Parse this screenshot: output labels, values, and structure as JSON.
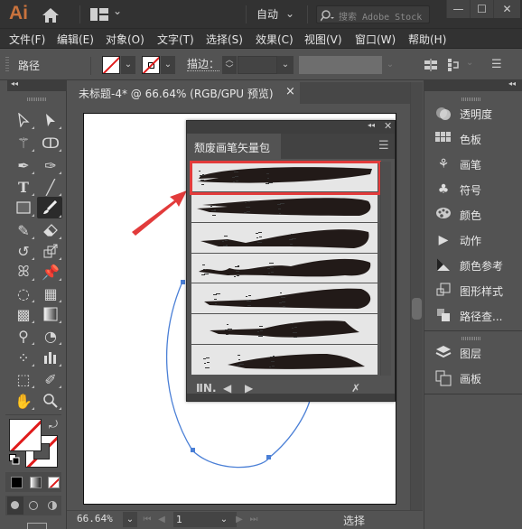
{
  "app": {
    "logo": "Ai",
    "workspace": "自动",
    "stock_search_placeholder": "搜索 Adobe Stock",
    "window_controls": {
      "minimize": "—",
      "maximize": "☐",
      "close": "✕"
    }
  },
  "menu": {
    "items": [
      "文件(F)",
      "编辑(E)",
      "对象(O)",
      "文字(T)",
      "选择(S)",
      "效果(C)",
      "视图(V)",
      "窗口(W)",
      "帮助(H)"
    ]
  },
  "control_bar": {
    "selection_label": "路径",
    "stroke_label": "描边：",
    "stroke_value": ""
  },
  "document": {
    "tab_title": "未标题-4* @ 66.64% (RGB/GPU 预览)",
    "tab_close": "×"
  },
  "status_bar": {
    "zoom": "66.64%",
    "page": "1",
    "status": "选择"
  },
  "brush_panel": {
    "title": "颓废画笔矢量包",
    "selected_index": 0,
    "brush_count": 7,
    "brushes": [
      "brush-1",
      "brush-2",
      "brush-3",
      "brush-4",
      "brush-5",
      "brush-6",
      "brush-7"
    ]
  },
  "right_panels": {
    "group1": [
      {
        "label": "透明度",
        "icon": "transparency-icon"
      },
      {
        "label": "色板",
        "icon": "swatches-icon"
      },
      {
        "label": "画笔",
        "icon": "brushes-icon"
      },
      {
        "label": "符号",
        "icon": "symbols-icon"
      },
      {
        "label": "颜色",
        "icon": "color-palette-icon"
      },
      {
        "label": "动作",
        "icon": "actions-play-icon"
      },
      {
        "label": "颜色参考",
        "icon": "color-guide-icon"
      },
      {
        "label": "图形样式",
        "icon": "graphic-styles-icon"
      },
      {
        "label": "路径查...",
        "icon": "pathfinder-icon"
      }
    ],
    "group2": [
      {
        "label": "图层",
        "icon": "layers-icon"
      },
      {
        "label": "画板",
        "icon": "artboards-icon"
      }
    ]
  },
  "colors": {
    "accent_red": "#e23b3b",
    "path_blue": "#4a7fd6",
    "app_orange": "#c9733d"
  }
}
